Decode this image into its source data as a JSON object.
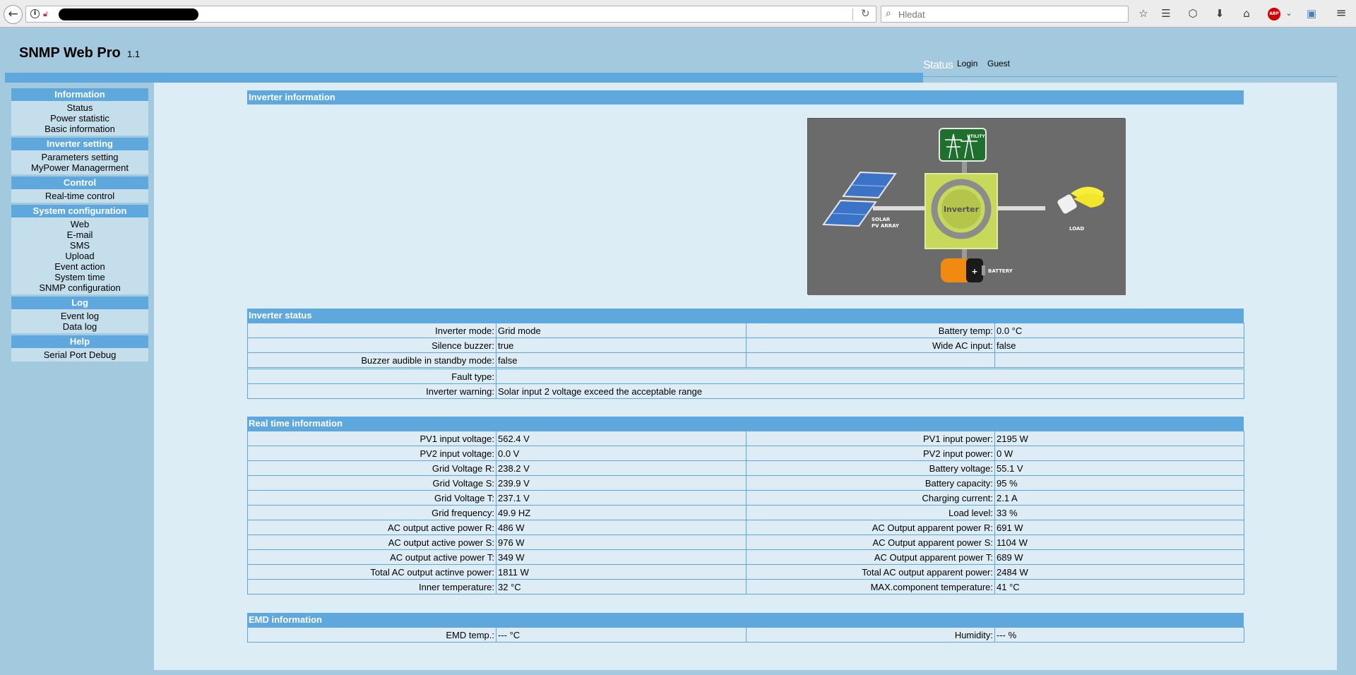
{
  "browser": {
    "search_placeholder": "Hledat"
  },
  "header": {
    "title": "SNMP Web Pro",
    "version": "1.1",
    "status_label": "Status",
    "login_label": "Login",
    "user_label": "Guest"
  },
  "sidebar": {
    "sections": [
      {
        "title": "Information",
        "items": [
          "Status",
          "Power statistic",
          "Basic information"
        ]
      },
      {
        "title": "Inverter setting",
        "items": [
          "Parameters setting",
          "MyPower Managerment"
        ]
      },
      {
        "title": "Control",
        "items": [
          "Real-time control"
        ]
      },
      {
        "title": "System configuration",
        "items": [
          "Web",
          "E-mail",
          "SMS",
          "Upload",
          "Event action",
          "System time",
          "SNMP configuration"
        ]
      },
      {
        "title": "Log",
        "items": [
          "Event log",
          "Data log"
        ]
      },
      {
        "title": "Help",
        "items": [
          "Serial Port Debug"
        ]
      }
    ]
  },
  "inverter_info": {
    "title": "Inverter information",
    "diagram": {
      "utility": "UTILITY",
      "solar": "SOLAR",
      "solar2": "PV ARRAY",
      "inverter": "Inverter",
      "load": "LOAD",
      "battery": "BATTERY"
    }
  },
  "inverter_status": {
    "title": "Inverter status",
    "inverter_mode_label": "Inverter mode:",
    "inverter_mode": "Grid mode",
    "battery_temp_label": "Battery temp:",
    "battery_temp": "0.0  °C",
    "silence_buzzer_label": "Silence buzzer:",
    "silence_buzzer": "true",
    "wide_ac_label": "Wide AC input:",
    "wide_ac": "false",
    "buzzer_standby_label": "Buzzer audible in standby mode:",
    "buzzer_standby": "false",
    "fault_type_label": "Fault type:",
    "fault_type": "",
    "warning_label": "Inverter warning:",
    "warning": "Solar input 2 voltage exceed the acceptable range"
  },
  "realtime": {
    "title": "Real time information",
    "rows": [
      {
        "l1": "PV1 input voltage:",
        "v1": "562.4  V",
        "l2": "PV1 input power:",
        "v2": "2195  W"
      },
      {
        "l1": "PV2 input voltage:",
        "v1": "0.0  V",
        "l2": "PV2 input power:",
        "v2": "0  W"
      },
      {
        "l1": "Grid Voltage R:",
        "v1": "238.2  V",
        "l2": "Battery voltage:",
        "v2": "55.1  V"
      },
      {
        "l1": "Grid Voltage S:",
        "v1": "239.9  V",
        "l2": "Battery capacity:",
        "v2": "95  %"
      },
      {
        "l1": "Grid Voltage T:",
        "v1": "237.1  V",
        "l2": "Charging current:",
        "v2": "2.1  A"
      },
      {
        "l1": "Grid frequency:",
        "v1": "49.9  HZ",
        "l2": "Load level:",
        "v2": "33  %"
      },
      {
        "l1": "AC output active power R:",
        "v1": "486  W",
        "l2": "AC Output apparent power R:",
        "v2": "691  W"
      },
      {
        "l1": "AC output active power S:",
        "v1": "976  W",
        "l2": "AC Output apparent power S:",
        "v2": "1104  W"
      },
      {
        "l1": "AC output active power T:",
        "v1": "349  W",
        "l2": "AC Output apparent power T:",
        "v2": "689  W"
      },
      {
        "l1": "Total AC output actinve power:",
        "v1": "1811  W",
        "l2": "Total AC output apparent power:",
        "v2": "2484  W"
      },
      {
        "l1": "Inner temperature:",
        "v1": "32  °C",
        "l2": "MAX.component temperature:",
        "v2": "41  °C"
      }
    ]
  },
  "emd": {
    "title": "EMD information",
    "temp_label": "EMD temp.:",
    "temp": "---  °C",
    "humidity_label": "Humidity:",
    "humidity": "---  %"
  }
}
